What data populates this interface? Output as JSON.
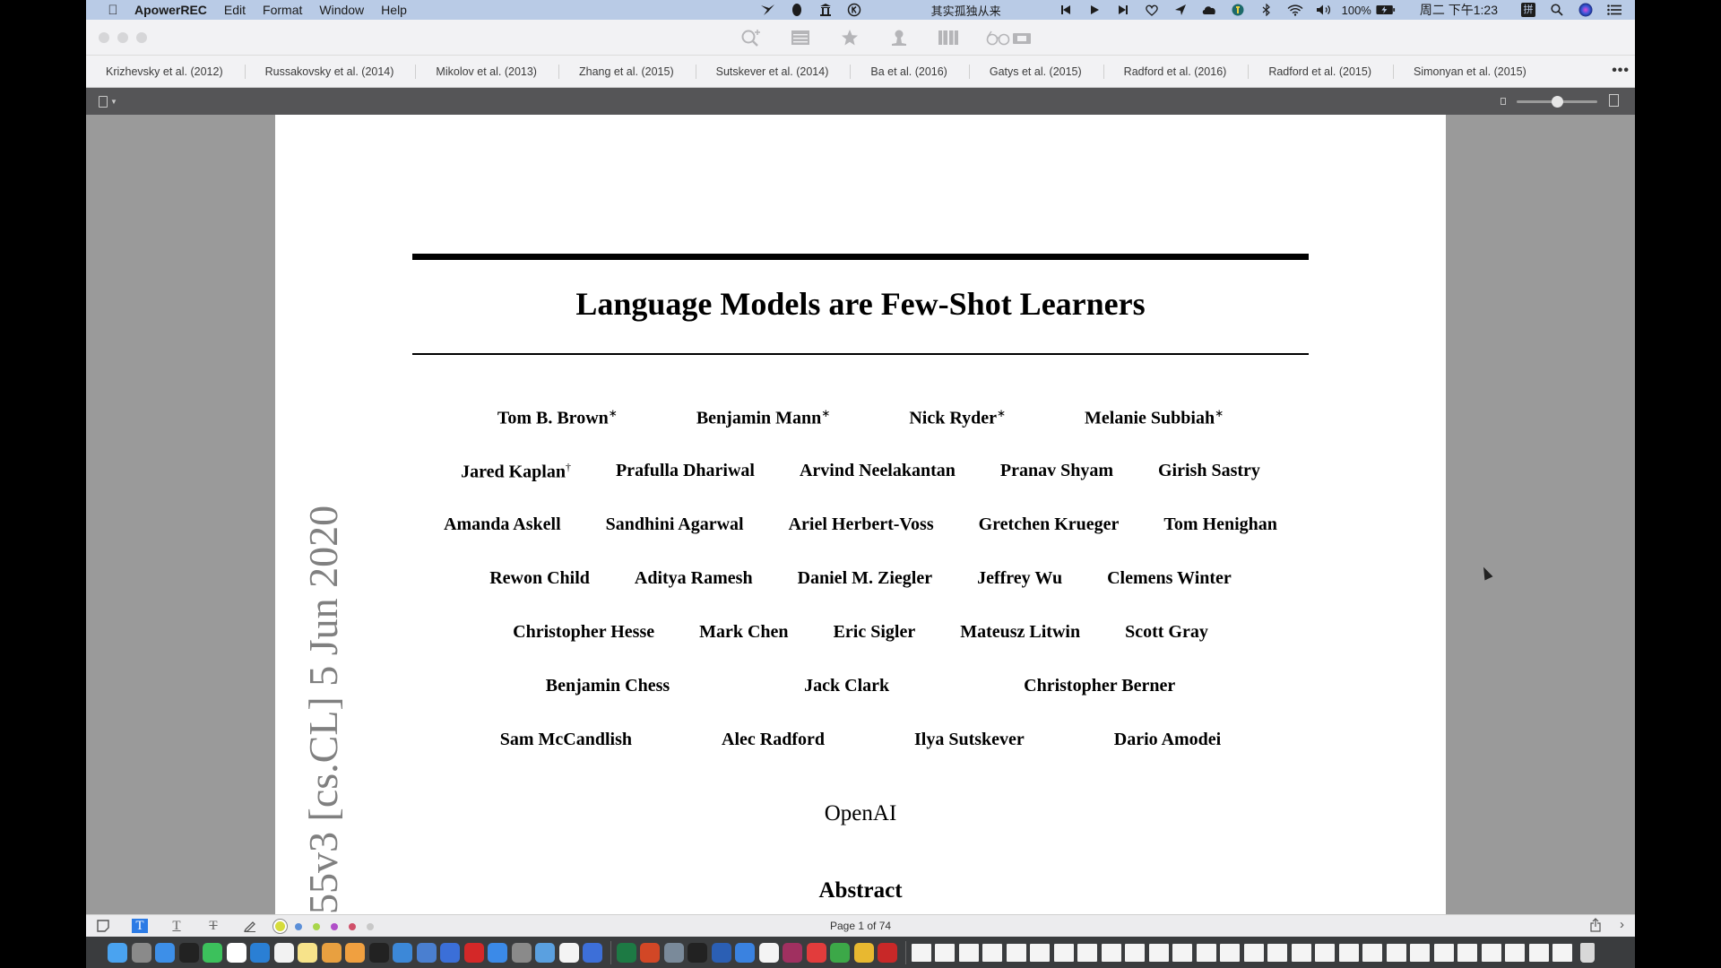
{
  "menubar": {
    "app_name": "ApowerREC",
    "menus": [
      "Edit",
      "Format",
      "Window",
      "Help"
    ],
    "now_playing": "其实孤独从来",
    "battery": "100%",
    "clock": "周二 下午1:23",
    "input_method": "拼",
    "status_icons": [
      "bird-icon",
      "qq-icon",
      "museum-icon",
      "k-circle-icon"
    ],
    "media_icons": [
      "previous-track-icon",
      "play-icon",
      "next-track-icon",
      "heart-icon",
      "send-icon",
      "cloud-icon",
      "app-badge-icon",
      "bluetooth-icon",
      "wifi-icon",
      "volume-icon"
    ]
  },
  "toolbar": {
    "icons": [
      "search-plus-icon",
      "list-icon",
      "star-icon",
      "person-icon",
      "book-icon",
      "glasses-icon"
    ]
  },
  "bookmarks": [
    "Krizhevsky et al. (2012)",
    "Russakovsky et al. (2014)",
    "Mikolov et al. (2013)",
    "Zhang et al. (2015)",
    "Sutskever et al. (2014)",
    "Ba et al. (2016)",
    "Gatys et al. (2015)",
    "Radford et al. (2016)",
    "Radford et al. (2015)",
    "Simonyan et al. (2015)"
  ],
  "bookmarks_more": "•••",
  "zoom_level": 0.5,
  "paper": {
    "title": "Language Models are Few-Shot Learners",
    "author_rows": [
      [
        {
          "name": "Tom B. Brown",
          "mark": "∗"
        },
        {
          "name": "Benjamin Mann",
          "mark": "∗"
        },
        {
          "name": "Nick Ryder",
          "mark": "∗"
        },
        {
          "name": "Melanie Subbiah",
          "mark": "∗"
        }
      ],
      [
        {
          "name": "Jared Kaplan",
          "mark": "†"
        },
        {
          "name": "Prafulla Dhariwal",
          "mark": ""
        },
        {
          "name": "Arvind Neelakantan",
          "mark": ""
        },
        {
          "name": "Pranav Shyam",
          "mark": ""
        },
        {
          "name": "Girish Sastry",
          "mark": ""
        }
      ],
      [
        {
          "name": "Amanda Askell",
          "mark": ""
        },
        {
          "name": "Sandhini Agarwal",
          "mark": ""
        },
        {
          "name": "Ariel Herbert-Voss",
          "mark": ""
        },
        {
          "name": "Gretchen Krueger",
          "mark": ""
        },
        {
          "name": "Tom Henighan",
          "mark": ""
        }
      ],
      [
        {
          "name": "Rewon Child",
          "mark": ""
        },
        {
          "name": "Aditya Ramesh",
          "mark": ""
        },
        {
          "name": "Daniel M. Ziegler",
          "mark": ""
        },
        {
          "name": "Jeffrey Wu",
          "mark": ""
        },
        {
          "name": "Clemens Winter",
          "mark": ""
        }
      ],
      [
        {
          "name": "Christopher Hesse",
          "mark": ""
        },
        {
          "name": "Mark Chen",
          "mark": ""
        },
        {
          "name": "Eric Sigler",
          "mark": ""
        },
        {
          "name": "Mateusz Litwin",
          "mark": ""
        },
        {
          "name": "Scott Gray",
          "mark": ""
        }
      ],
      [
        {
          "name": "Benjamin Chess",
          "mark": ""
        },
        {
          "name": "Jack Clark",
          "mark": ""
        },
        {
          "name": "Christopher Berner",
          "mark": ""
        }
      ],
      [
        {
          "name": "Sam McCandlish",
          "mark": ""
        },
        {
          "name": "Alec Radford",
          "mark": ""
        },
        {
          "name": "Ilya Sutskever",
          "mark": ""
        },
        {
          "name": "Dario Amodei",
          "mark": ""
        }
      ]
    ],
    "affiliation": "OpenAI",
    "abstract_heading": "Abstract",
    "arxiv_stamp": "55v3  [cs.CL]  5 Jun 2020"
  },
  "bottombar": {
    "tools": [
      "note-icon",
      "text-box-icon",
      "underline-text-icon",
      "strikethrough-text-icon",
      "pen-icon"
    ],
    "colors": [
      "#d6dc3c",
      "#5b8fd8",
      "#a8d64a",
      "#b04fc8",
      "#d0506a",
      "#c8c8c8"
    ],
    "selected_color_index": 0,
    "page_indicator": "Page 1 of 74"
  },
  "dock": {
    "apps": [
      "Finder",
      "Launchpad",
      "Safari",
      "QQ",
      "WeChat",
      "Calendar",
      "VS Code",
      "Reminders",
      "Notes",
      "Photos",
      "Pages",
      "Terminal",
      "Keynote",
      "Archive",
      "Kuaiya",
      "NetEase Music",
      "App Store",
      "System Preferences",
      "Preview",
      "TextEdit",
      "WPS",
      "Excel",
      "PowerPoint",
      "Image Capture",
      "Activity Monitor",
      "Word",
      "Airmail",
      "Baidu Netdisk",
      "Instruments",
      "XMind",
      "Evernote",
      "Chrome",
      "Parallels"
    ],
    "app_colors": [
      "#4aa3f0",
      "#8a8a8a",
      "#3d8fe8",
      "#222",
      "#3cc15c",
      "#fff",
      "#2a7fd4",
      "#f2f2f2",
      "#f7e38a",
      "#e8a040",
      "#f0a040",
      "#222",
      "#3c88d8",
      "#4a7fd0",
      "#3b6fd8",
      "#d42828",
      "#3b8ae8",
      "#8a8a8a",
      "#5aa0e0",
      "#f4f4f4",
      "#3d6fd8",
      "#1d7a44",
      "#d24726",
      "#7a8a9a",
      "#222",
      "#2b5fb4",
      "#3a82e0",
      "#f4f4f4",
      "#a03060",
      "#e23c3c",
      "#3ca848",
      "#e8b830",
      "#c82828"
    ],
    "document_count": 28
  }
}
